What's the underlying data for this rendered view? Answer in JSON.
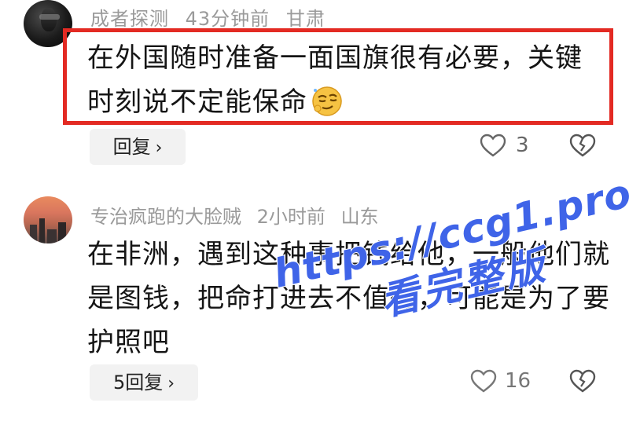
{
  "comments": [
    {
      "username": "成者探测",
      "time": "43分钟前",
      "location": "甘肃",
      "text": "在外国随时准备一面国旗很有必要，关键时刻说不定能保命",
      "emoji": "smirking-face-emoji",
      "reply_label": "回复",
      "like_count": "3",
      "highlighted": true,
      "highlight_color": "#e32a23"
    },
    {
      "username": "专治疯跑的大脸贼",
      "time": "2小时前",
      "location": "山东",
      "text": "在非洲，遇到这种事把钱给他，一般他们就是图钱，把命打进去不值得，可能是为了要护照吧",
      "reply_label": "5回复",
      "like_count": "16"
    }
  ],
  "watermark": {
    "url": "https://ccg1.pro",
    "caption": "看完整版",
    "color": "#3f64e8"
  },
  "icons": {
    "like": "heart-outline-icon",
    "dislike": "broken-heart-icon",
    "chevron": "chevron-right-icon"
  }
}
